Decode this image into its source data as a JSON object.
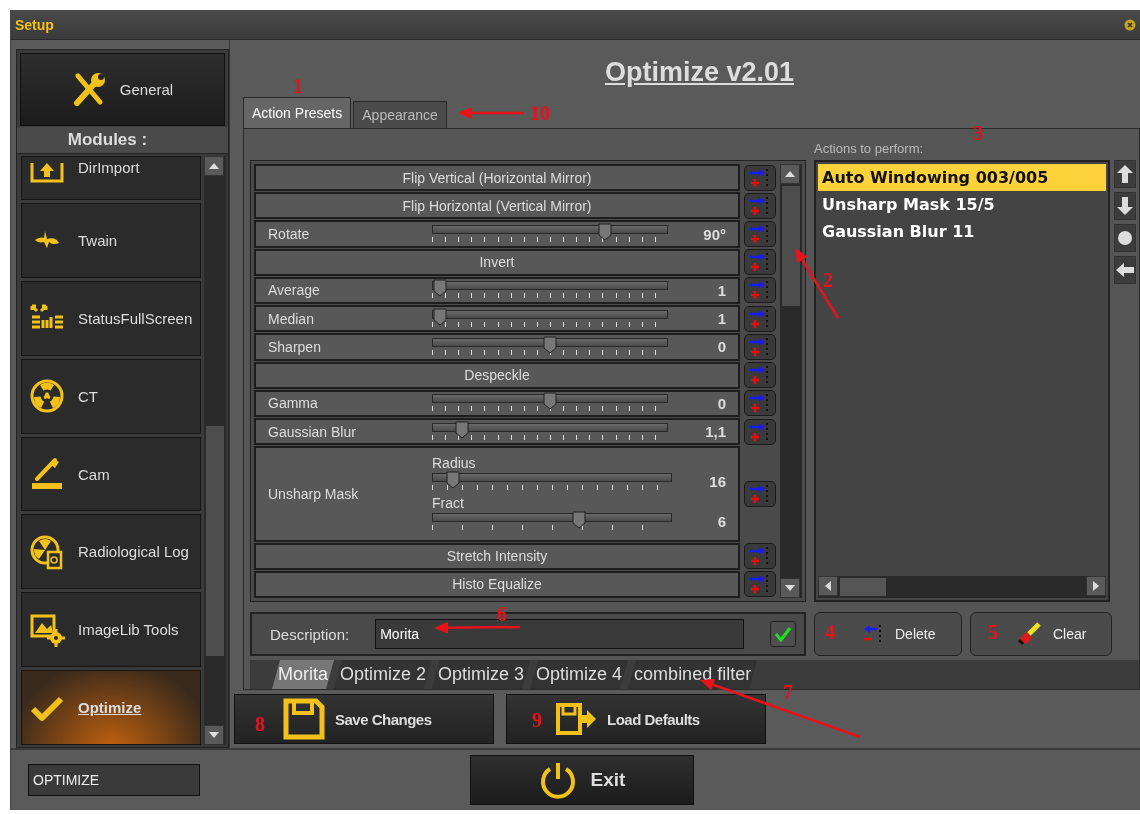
{
  "window": {
    "title": "Setup"
  },
  "general_button": {
    "label": "General"
  },
  "modules_header": "Modules :",
  "modules": [
    {
      "label": "DirImport",
      "selected": false
    },
    {
      "label": "Twain",
      "selected": false
    },
    {
      "label": "StatusFullScreen",
      "selected": false
    },
    {
      "label": "CT",
      "selected": false
    },
    {
      "label": "Cam",
      "selected": false
    },
    {
      "label": "Radiological Log",
      "selected": false
    },
    {
      "label": "ImageLib Tools",
      "selected": false
    },
    {
      "label": "Optimize",
      "selected": true
    }
  ],
  "module_field": {
    "value": "OPTIMIZE"
  },
  "heading": "Optimize v2.01",
  "tabs": [
    {
      "label": "Action Presets",
      "selected": true
    },
    {
      "label": "Appearance",
      "selected": false
    }
  ],
  "filters": [
    {
      "kind": "button",
      "label": "Flip Vertical (Horizontal Mirror)"
    },
    {
      "kind": "button",
      "label": "Flip Horizontal (Vertical Mirror)"
    },
    {
      "kind": "slider",
      "label": "Rotate",
      "level": 0.75,
      "reading": "90°"
    },
    {
      "kind": "button",
      "label": "Invert"
    },
    {
      "kind": "slider",
      "label": "Average",
      "level": 0,
      "reading": "1"
    },
    {
      "kind": "slider",
      "label": "Median",
      "level": 0,
      "reading": "1"
    },
    {
      "kind": "slider",
      "label": "Sharpen",
      "level": 0.5,
      "reading": "0"
    },
    {
      "kind": "button",
      "label": "Despeckle"
    },
    {
      "kind": "slider",
      "label": "Gamma",
      "level": 0.5,
      "reading": "0"
    },
    {
      "kind": "slider",
      "label": "Gaussian Blur",
      "level": 0.1,
      "reading": "1,1"
    },
    {
      "kind": "double",
      "label": "Unsharp Mask",
      "sliders": [
        {
          "label": "Radius",
          "level": 0.06,
          "reading": "16"
        },
        {
          "label": "Fract",
          "level": 0.62,
          "reading": "6"
        }
      ]
    },
    {
      "kind": "button",
      "label": "Stretch Intensity"
    },
    {
      "kind": "button",
      "label": "Histo Equalize"
    }
  ],
  "actions_label": "Actions to perform:",
  "actions": [
    {
      "label": "Auto Windowing 003/005",
      "selected": true
    },
    {
      "label": "Unsharp Mask 15/5",
      "selected": false
    },
    {
      "label": "Gaussian Blur 11",
      "selected": false
    }
  ],
  "description": {
    "label": "Description:",
    "value": "Morita"
  },
  "delete_button": "Delete",
  "clear_button": "Clear",
  "presets": [
    {
      "label": "Morita",
      "selected": true
    },
    {
      "label": "Optimize 2",
      "selected": false
    },
    {
      "label": "Optimize 3",
      "selected": false
    },
    {
      "label": "Optimize 4",
      "selected": false
    },
    {
      "label": "combined filter",
      "selected": false
    }
  ],
  "save_button": "Save Changes",
  "load_button": "Load Defaults",
  "exit_button": "Exit",
  "annotations": [
    {
      "label": "1"
    },
    {
      "label": "10"
    },
    {
      "label": "3"
    },
    {
      "label": "2"
    },
    {
      "label": "6"
    },
    {
      "label": "4"
    },
    {
      "label": "5"
    },
    {
      "label": "7"
    },
    {
      "label": "8"
    },
    {
      "label": "9"
    }
  ]
}
